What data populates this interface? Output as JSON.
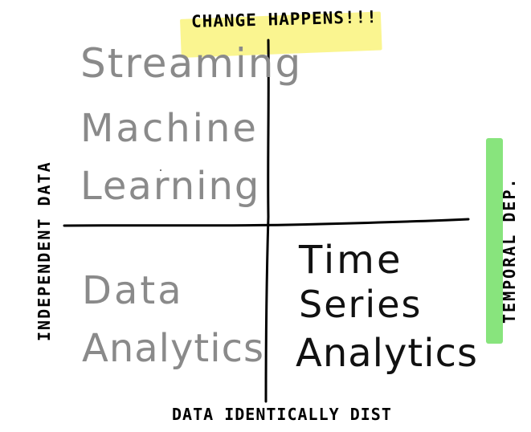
{
  "axes": {
    "top": "CHANGE HAPPENS!!!",
    "bottom": "DATA IDENTICALLY DIST",
    "left": "INDEPENDENT DATA",
    "right": "TEMPORAL DEP."
  },
  "quadrants": {
    "top_left": [
      "Streaming",
      "Machine",
      "Learning"
    ],
    "bottom_left": [
      "Data",
      "Analytics"
    ],
    "bottom_right": [
      "Time",
      "Series",
      "Analytics"
    ]
  },
  "colors": {
    "highlight_top": "#faf590",
    "highlight_right": "#88e47d",
    "text_gray": "#8a8a8a",
    "text_dark": "#111111",
    "axis_stroke": "#000000"
  }
}
